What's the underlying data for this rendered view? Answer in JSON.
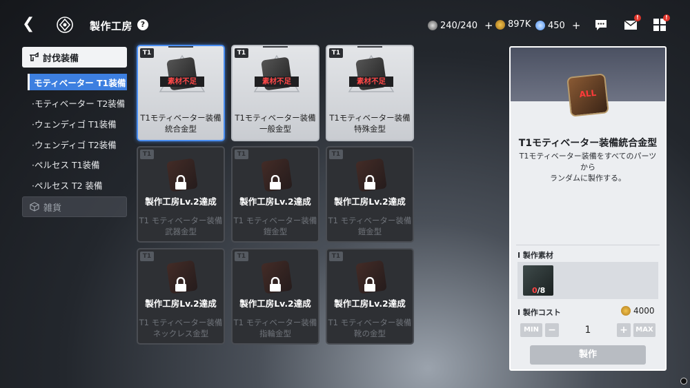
{
  "header": {
    "title": "製作工房",
    "help": "?",
    "stamina": "240/240",
    "coins": "897K",
    "gems": "450",
    "plus": "+",
    "badge": "!"
  },
  "sidebar": {
    "category_active": "討伐装備",
    "items": [
      {
        "label": "モティベーター T1装備"
      },
      {
        "label": "·モティベーター T2装備"
      },
      {
        "label": "·ウェンディゴ T1装備"
      },
      {
        "label": "·ウェンディゴ T2装備"
      },
      {
        "label": "·ペルセス T1装備"
      },
      {
        "label": "·ペルセス T2 装備"
      }
    ],
    "category_other": "雑貨"
  },
  "grid": {
    "tier": "T1",
    "shortage": "素材不足",
    "lock_msg": "製作工房Lv.2達成",
    "cards": [
      {
        "line1": "T1モティベーター装備",
        "line2": "統合金型"
      },
      {
        "line1": "T1モティベーター装備",
        "line2": "一般金型"
      },
      {
        "line1": "T1モティベーター装備",
        "line2": "特殊金型"
      },
      {
        "line1": "T1 モティベーター装備",
        "line2": "武器金型"
      },
      {
        "line1": "T1 モティベーター装備",
        "line2": "鎧金型"
      },
      {
        "line1": "T1 モティベーター装備",
        "line2": "鎧金型"
      },
      {
        "line1": "T1 モティベーター装備",
        "line2": "ネックレス金型"
      },
      {
        "line1": "T1 モティベーター装備",
        "line2": "指輪金型"
      },
      {
        "line1": "T1 モティベーター装備",
        "line2": "靴の金型"
      }
    ]
  },
  "detail": {
    "badge_text": "ALL",
    "title": "T1モティベーター装備統合金型",
    "desc_line1": "T1モティベーター装備をすべてのパーツから",
    "desc_line2": "ランダムに製作する。",
    "materials_label": "I 製作素材",
    "mat_have": "0",
    "mat_need": "/8",
    "cost_label": "I 製作コスト",
    "cost_value": "4000",
    "min": "MIN",
    "minus": "−",
    "quantity": "1",
    "plus": "+",
    "max": "MAX",
    "craft_button": "製作"
  }
}
